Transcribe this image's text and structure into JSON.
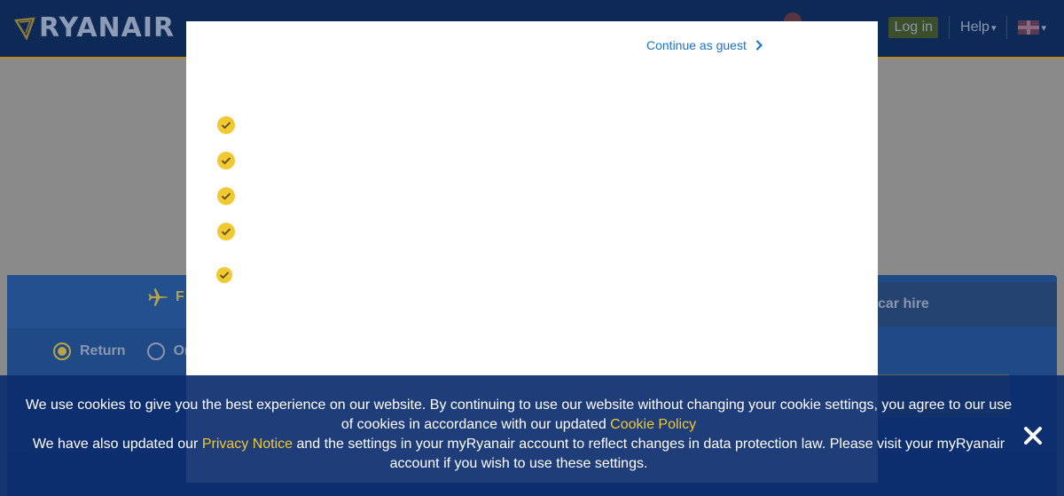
{
  "header": {
    "logo_text": "RYANAIR",
    "login_label": "Log in",
    "help_label": "Help"
  },
  "search": {
    "tab_flights_label": "F",
    "tab_car_hire_label": "car hire",
    "radio_return_label": "Return",
    "radio_oneway_label": "One"
  },
  "modal": {
    "continue_guest_label": "Continue as guest",
    "benefit_count_visible": 5
  },
  "cookie_banner": {
    "line1_pre": "We use cookies to give you the best experience on our website. By continuing to use our website without changing your cookie settings, you agree to our use of cookies in accordance with our updated ",
    "cookie_policy_link": "Cookie Policy",
    "line2_pre": "We have also updated our ",
    "privacy_notice_link": "Privacy Notice",
    "line2_post": " and the settings in your myRyanair account to reflect changes in data protection law. Please visit your myRyanair account if you wish to use these settings."
  },
  "colors": {
    "header_bg": "#0d2a57",
    "check_yellow": "#f1c933",
    "link_blue": "#1a73c9",
    "cookie_link": "#f1c933"
  },
  "icons": {
    "check": "check-circle-icon",
    "chevron": "chevron-right-icon",
    "close": "close-icon",
    "plane": "plane-icon",
    "flag": "uk-flag-icon"
  }
}
